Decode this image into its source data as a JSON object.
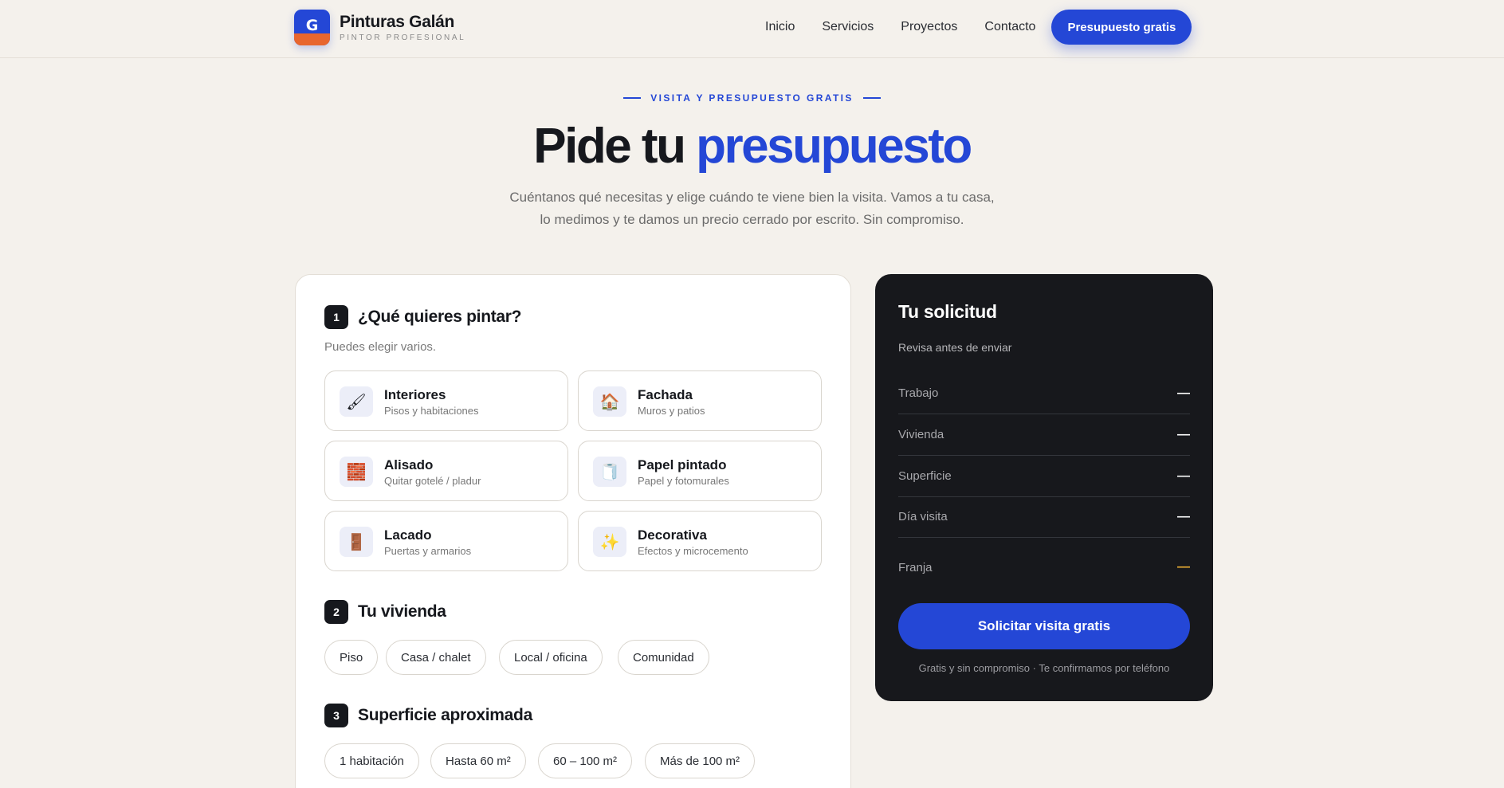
{
  "header": {
    "logo_letter": "G",
    "brand_name": "Pinturas Galán",
    "brand_tag": "PINTOR PROFESIONAL",
    "nav": [
      "Inicio",
      "Servicios",
      "Proyectos",
      "Contacto"
    ],
    "cta_label": "Presupuesto gratis"
  },
  "hero": {
    "eyebrow": "VISITA Y PRESUPUESTO GRATIS",
    "title_main": "Pide tu ",
    "title_accent": "presupuesto",
    "subtitle_line1": "Cuéntanos qué necesitas y elige cuándo te viene bien la visita. Vamos a tu casa,",
    "subtitle_line2": "lo medimos y te damos un precio cerrado por escrito. Sin compromiso."
  },
  "form": {
    "step1": {
      "number": "1",
      "title": "¿Qué quieres pintar?",
      "hint": "Puedes elegir varios.",
      "options": [
        {
          "title": "Interiores",
          "sub": "Pisos y habitaciones",
          "icon": "paintbrush-icon",
          "glyph": "🖌"
        },
        {
          "title": "Fachada",
          "sub": "Muros y patios",
          "icon": "house-icon",
          "glyph": "🏠"
        },
        {
          "title": "Alisado",
          "sub": "Quitar gotelé / pladur",
          "icon": "brick-icon",
          "glyph": "🧱"
        },
        {
          "title": "Papel pintado",
          "sub": "Papel y fotomurales",
          "icon": "paper-roll-icon",
          "glyph": "🧻"
        },
        {
          "title": "Lacado",
          "sub": "Puertas y armarios",
          "icon": "door-icon",
          "glyph": "🚪"
        },
        {
          "title": "Decorativa",
          "sub": "Efectos y microcemento",
          "icon": "sparkles-icon",
          "glyph": "✨"
        }
      ]
    },
    "step2": {
      "number": "2",
      "title": "Tu vivienda",
      "options": [
        "Piso",
        "Casa / chalet",
        "Local / oficina",
        "Comunidad"
      ]
    },
    "step3": {
      "number": "3",
      "title": "Superficie aproximada",
      "options": [
        "1 habitación",
        "Hasta 60 m²",
        "60 – 100 m²",
        "Más de 100 m²"
      ]
    }
  },
  "summary": {
    "title": "Tu solicitud",
    "subtitle": "Revisa antes de enviar",
    "rows": [
      {
        "label": "Trabajo",
        "value": "—"
      },
      {
        "label": "Vivienda",
        "value": "—"
      },
      {
        "label": "Superficie",
        "value": "—"
      },
      {
        "label": "Día visita",
        "value": "—"
      },
      {
        "label": "Franja",
        "value": "—"
      }
    ],
    "submit_label": "Solicitar visita gratis",
    "note": "Gratis y sin compromiso · Te confirmamos por teléfono",
    "colors": {
      "accent": "#2447d6",
      "warning": "#f2b233",
      "card_bg": "#17181c"
    }
  }
}
